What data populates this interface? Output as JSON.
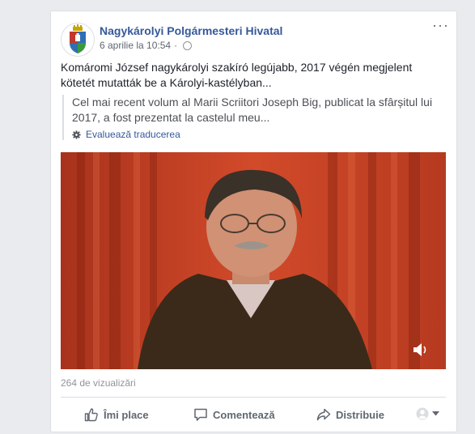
{
  "post": {
    "page_name": "Nagykárolyi Polgármesteri Hivatal",
    "timestamp": "6 aprilie la 10:54",
    "separator": "·",
    "text": "Komáromi József nagykárolyi szakíró legújabb, 2017 végén megjelent kötetét mutatták be a Károlyi-kastélyban...",
    "translation": "Cel mai recent volum al Marii Scriitori Joseph Big, publicat la sfârșitul lui 2017, a fost prezentat la castelul meu...",
    "translation_link": "Evaluează traducerea",
    "more_label": "···",
    "views": "264 de vizualizări"
  },
  "actions": {
    "like": "Îmi place",
    "comment": "Comentează",
    "share": "Distribuie"
  },
  "icons": {
    "privacy": "globe-icon",
    "settings": "gear-icon",
    "like": "thumbs-up-icon",
    "comment": "comment-icon",
    "share": "share-arrow-icon",
    "reactions": "avatar-icon",
    "sound": "speaker-icon"
  },
  "colors": {
    "link": "#365899",
    "text": "#1d2129",
    "secondary": "#606770",
    "background": "#e9ebee"
  }
}
